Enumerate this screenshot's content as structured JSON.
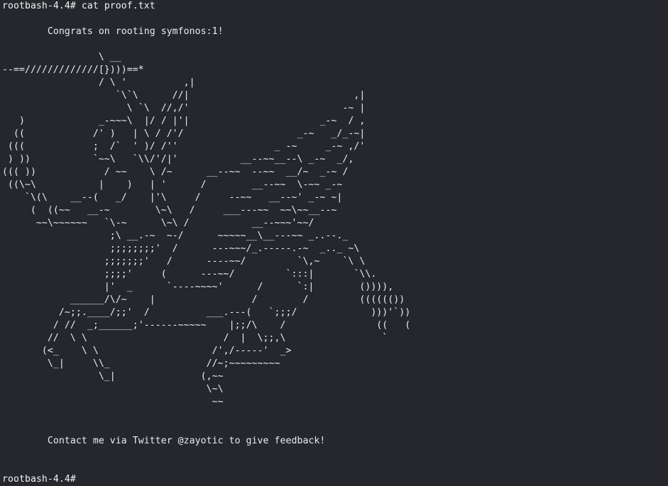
{
  "terminal": {
    "prompt": "rootbash-4.4#",
    "command": " cat proof.txt",
    "final_prompt": "rootbash-4.4#",
    "lines": [
      "",
      "        Congrats on rooting symfonos:1!",
      "",
      "                 \\ __",
      "--==/////////////[})))==*",
      "                 / \\ '          ,|",
      "                    `\\`\\      //|                             ,|",
      "                      \\ `\\  //,/'                           -~ |",
      "   )             _-~~~\\  |/ / |'|                       _-~  / ,",
      "  ((            /' )   | \\ / /'/                    _-~   _/_-~|",
      " (((            ;  /`  ' )/ /''                 _ -~     _-~ ,/'",
      " ) ))           `~~\\   `\\\\/'/|'           __--~~__--\\ _-~  _/,",
      "((( ))            / ~~    \\ /~      __--~~  --~~  __/~  _-~ /",
      " ((\\~\\           |    )   | '      /        __--~~  \\-~~ _-~",
      "    `\\(\\    __--(   _/    |'\\     /     --~~   __--~' _-~ ~|",
      "     (  ((~~   __-~        \\~\\   /     ___---~~  ~~\\~~__--~",
      "      ~~\\~~~~~~   `\\-~      \\~\\ /           __--~~~'~~/",
      "                   ;\\ __.-~  ~-/      ~~~~~__\\__---~~ _..--._",
      "                   ;;;;;;;;'  /      ---~~~/_.-----.-~  _.._ ~\\",
      "                  ;;;;;;;'   /      ----~~/         `\\,~    `\\ \\",
      "                  ;;;;'     (      ---~~/         `:::|       `\\\\.",
      "                  |'  _      `----~~~~'      /      `:|        ()))),",
      "            ______/\\/~    |                 /        /         (((((())",
      "          /~;;.____/;;'  /          ___.---(   `;;;/             )))'`))",
      "         / //  _;______;'------~~~~~    |;;/\\    /                ((   (",
      "        //  \\ \\                        /  |  \\;;,\\                 `",
      "       (<_    \\ \\                    /',/-----'  _>",
      "        \\_|     \\\\_                 //~;~~~~~~~~~",
      "                 \\_|               (,~~",
      "                                    \\~\\",
      "                                     ~~",
      "",
      "",
      "        Contact me via Twitter @zayotic to give feedback!",
      "",
      ""
    ]
  }
}
